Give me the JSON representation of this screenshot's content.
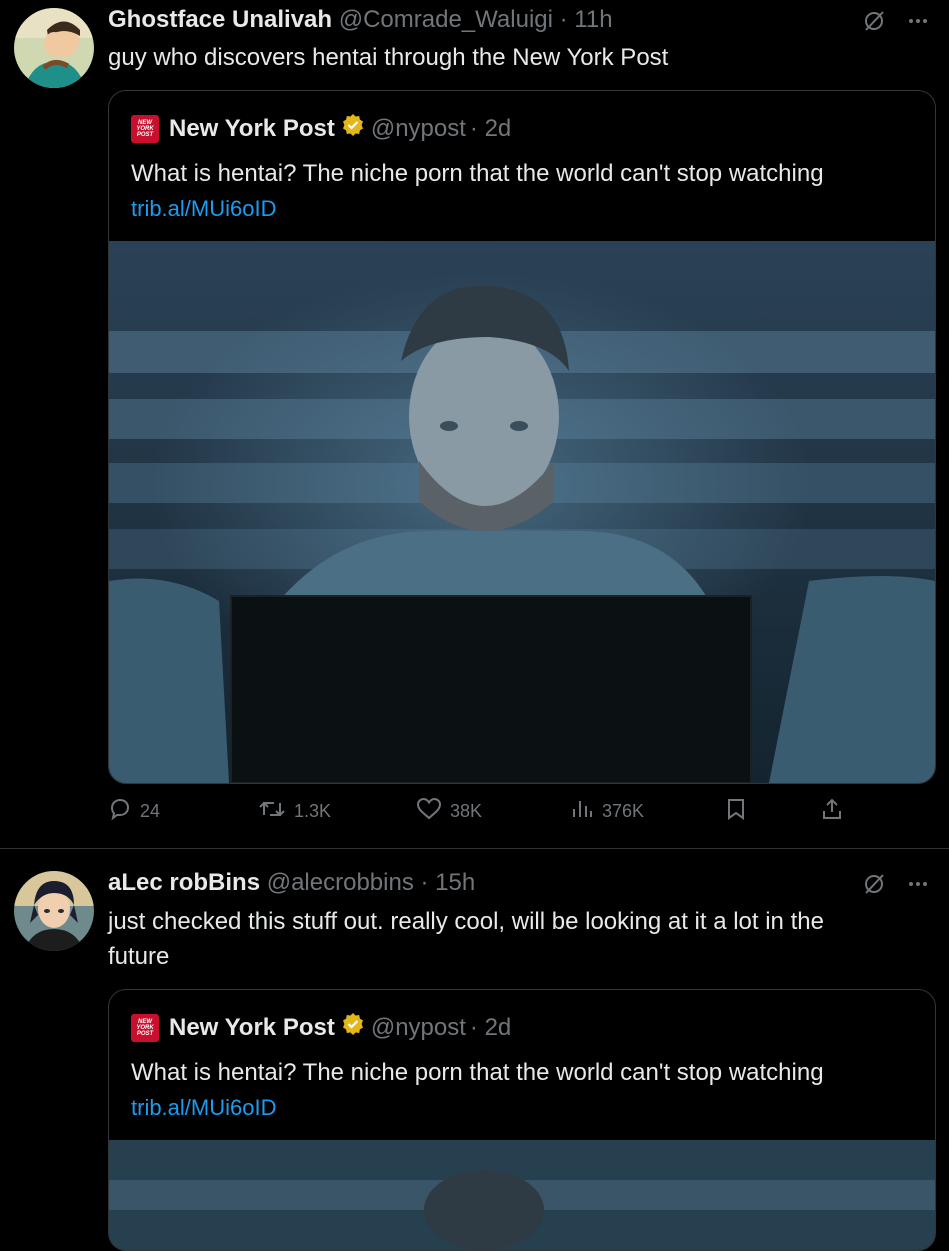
{
  "tweets": [
    {
      "author_name": "Ghostface Unalivah",
      "author_handle": "@Comrade_Waluigi",
      "time": "· 11h",
      "text": "guy who discovers hentai through the New York Post",
      "quote": {
        "logo_text": [
          "NEW",
          "YORK",
          "POST"
        ],
        "author_name": "New York Post",
        "author_handle": "@nypost",
        "time": "· 2d",
        "text": "What is hentai? The niche porn that the world can't stop watching",
        "link": "trib.al/MUi6oID"
      },
      "stats": {
        "replies": "24",
        "reposts": "1.3K",
        "likes": "38K",
        "views": "376K"
      }
    },
    {
      "author_name": "aLec robBins",
      "author_handle": "@alecrobbins",
      "time": "· 15h",
      "text_line1": "just checked this stuff out. really cool, will be looking at it a lot in the",
      "text_line2": "future",
      "quote": {
        "logo_text": [
          "NEW",
          "YORK",
          "POST"
        ],
        "author_name": "New York Post",
        "author_handle": "@nypost",
        "time": "· 2d",
        "text": "What is hentai? The niche porn that the world can't stop watching",
        "link": "trib.al/MUi6oID"
      }
    }
  ],
  "icons": {
    "grok": "grok-icon",
    "more": "more-icon",
    "reply": "reply-icon",
    "repost": "repost-icon",
    "like": "heart-icon",
    "views": "views-icon",
    "bookmark": "bookmark-icon",
    "share": "share-icon"
  },
  "colors": {
    "background": "#000000",
    "text": "#e7e9ea",
    "muted": "#71767b",
    "link": "#1d9bf0",
    "nypost_red": "#c8102e",
    "verified_gold": "#e2b719"
  }
}
